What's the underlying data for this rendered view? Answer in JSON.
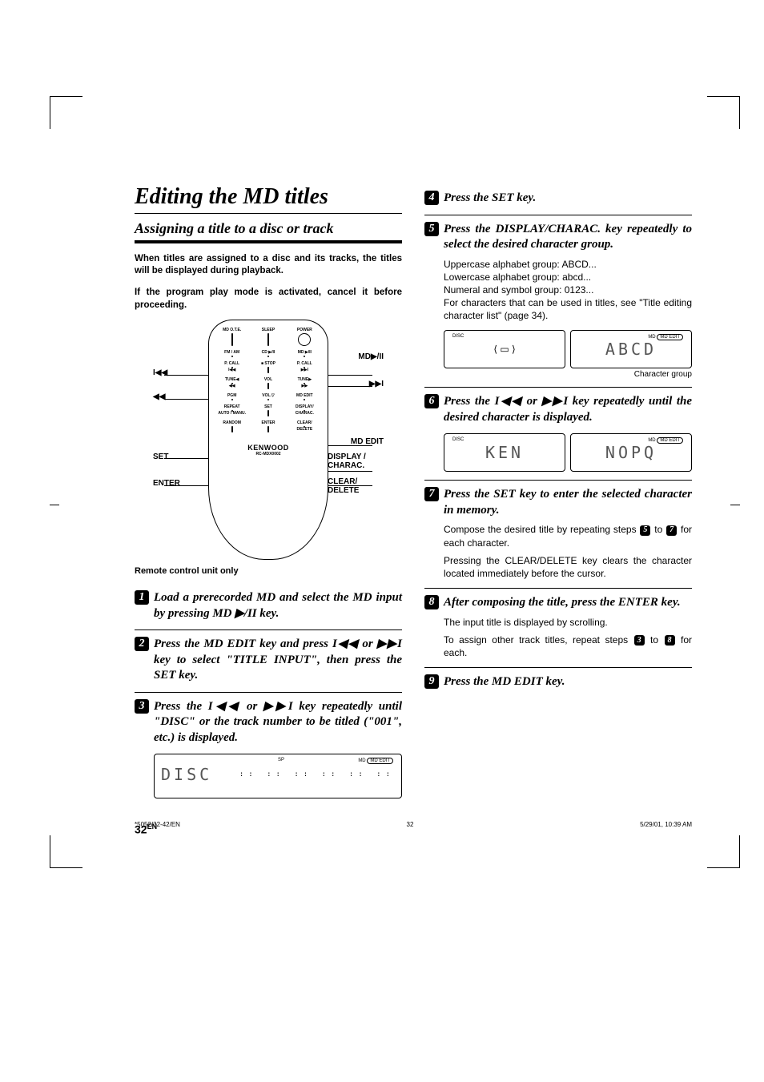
{
  "title": "Editing the MD titles",
  "subtitle": "Assigning a title to a disc or track",
  "intro1": "When titles are assigned to a disc and its tracks, the titles will be displayed during playback.",
  "intro2": "If the program play mode is activated, cancel it before proceeding.",
  "remote": {
    "brand": "KENWOOD",
    "model": "RC-MDX0002",
    "labels": {
      "mdote": "MD O.T.E.",
      "sleep": "SLEEP",
      "power": "POWER",
      "fmam": "FM / AM",
      "cd": "CD ▶/II",
      "md": "MD ▶/II",
      "pcall1": "P. CALL",
      "stop": "■ STOP",
      "pcall2": "P. CALL",
      "skipb": "I◀◀",
      "skipf": "▶▶I",
      "tuneb": "TUNE◀",
      "vol": "VOL",
      "tunef": "TUNE▶",
      "rewb": "◀◀",
      "fwdf": "▶▶",
      "pgm": "PGM",
      "volb": "VOL.▽",
      "mdedit": "MD EDIT",
      "repeat": "REPEAT",
      "repeat2": "AUTO / MANU.",
      "set": "SET",
      "display": "DISPLAY/",
      "display2": "CHARAC.",
      "random": "RANDOM",
      "enter": "ENTER",
      "clear": "CLEAR/",
      "clear2": "DELETE"
    },
    "leads": {
      "l_skip": "I◀◀",
      "l_rew": "◀◀",
      "l_set": "SET",
      "l_enter": "ENTER",
      "r_md": "MD▶/II",
      "r_ff": "▶▶I",
      "r_mdedit": "MD EDIT",
      "r_display": "DISPLAY / CHARAC.",
      "r_clear": "CLEAR/ DELETE"
    }
  },
  "caption_remote": "Remote control unit only",
  "steps": {
    "s1": "Load a prerecorded MD and select the MD input  by pressing MD ▶/II key.",
    "s2": "Press the MD EDIT key and press I◀◀ or ▶▶I key to select \"TITLE INPUT\", then press the SET key.",
    "s3": "Press the I◀◀ or ▶▶I key repeatedly until \"DISC\" or the track number to be titled (\"001\", etc.) is displayed.",
    "s4": "Press the SET key.",
    "s5": "Press the DISPLAY/CHARAC. key repeatedly to select the desired character group.",
    "s5_body1": "Uppercase alphabet group: ABCD...",
    "s5_body2": "Lowercase alphabet group: abcd...",
    "s5_body3": "Numeral and symbol group: 0123...",
    "s5_body4": "For characters that can be used in titles, see \"Title editing character list\" (page 34).",
    "s5_sub": "Character group",
    "s6": "Press the I◀◀ or ▶▶I key repeatedly until the desired character is displayed.",
    "s7": "Press the SET key to enter the selected character in memory.",
    "s7_body1_a": "Compose the desired title by repeating steps ",
    "s7_body1_b": " to ",
    "s7_body1_c": " for each character.",
    "s7_body2": "Pressing the CLEAR/DELETE key clears the character located immediately before the cursor.",
    "s8": "After composing the title, press the ENTER key.",
    "s8_body1": "The input title is displayed by scrolling.",
    "s8_body2_a": "To assign other track titles, repeat steps ",
    "s8_body2_b": " to ",
    "s8_body2_c": " for each.",
    "s9": "Press the MD EDIT key."
  },
  "lcd": {
    "disc_tag": "DISC",
    "sp_tag": "SP",
    "md_tag": "MD",
    "mdedit_tag": "MD EDIT",
    "disc_text": "DISC",
    "abcd_text": "ABCD",
    "ken_text": "KEN",
    "nopq_text": "NOPQ"
  },
  "page_number": "32",
  "page_lang": "EN",
  "footer": {
    "left": "*5052/32-42/EN",
    "center": "32",
    "right": "5/29/01, 10:39 AM"
  }
}
